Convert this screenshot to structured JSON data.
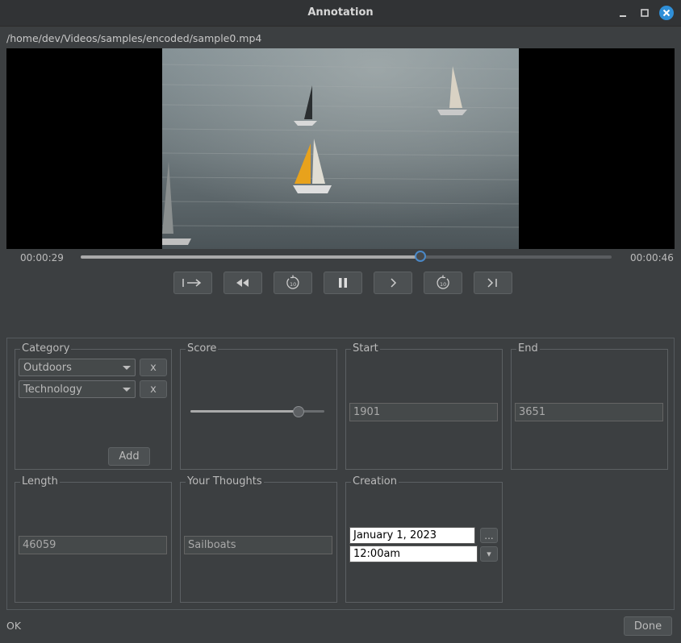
{
  "window": {
    "title": "Annotation",
    "accent": "#2f8fd8"
  },
  "file_path": "/home/dev/Videos/samples/encoded/sample0.mp4",
  "player": {
    "current_time": "00:00:29",
    "total_time": "00:00:46",
    "progress_fraction": 0.64,
    "controls": [
      {
        "name": "go-to-start-button",
        "icon": "jump-to-start-icon"
      },
      {
        "name": "rewind-button",
        "icon": "rewind-icon"
      },
      {
        "name": "back-10-button",
        "icon": "replay-10-icon"
      },
      {
        "name": "pause-button",
        "icon": "pause-icon"
      },
      {
        "name": "next-frame-button",
        "icon": "chevron-right-icon"
      },
      {
        "name": "forward-10-button",
        "icon": "forward-10-icon"
      },
      {
        "name": "go-to-end-button",
        "icon": "skip-to-end-icon"
      }
    ]
  },
  "form": {
    "category": {
      "label": "Category",
      "items": [
        "Outdoors",
        "Technology"
      ],
      "remove_label": "x",
      "add_label": "Add"
    },
    "score": {
      "label": "Score",
      "value_fraction": 0.81
    },
    "start": {
      "label": "Start",
      "value": "1901"
    },
    "end": {
      "label": "End",
      "value": "3651"
    },
    "length": {
      "label": "Length",
      "value": "46059"
    },
    "thoughts": {
      "label": "Your Thoughts",
      "value": "Sailboats"
    },
    "creation": {
      "label": "Creation",
      "date": "January 1, 2023",
      "date_button": "...",
      "time": "12:00am",
      "time_button": "▾"
    }
  },
  "status": "OK",
  "done_label": "Done"
}
